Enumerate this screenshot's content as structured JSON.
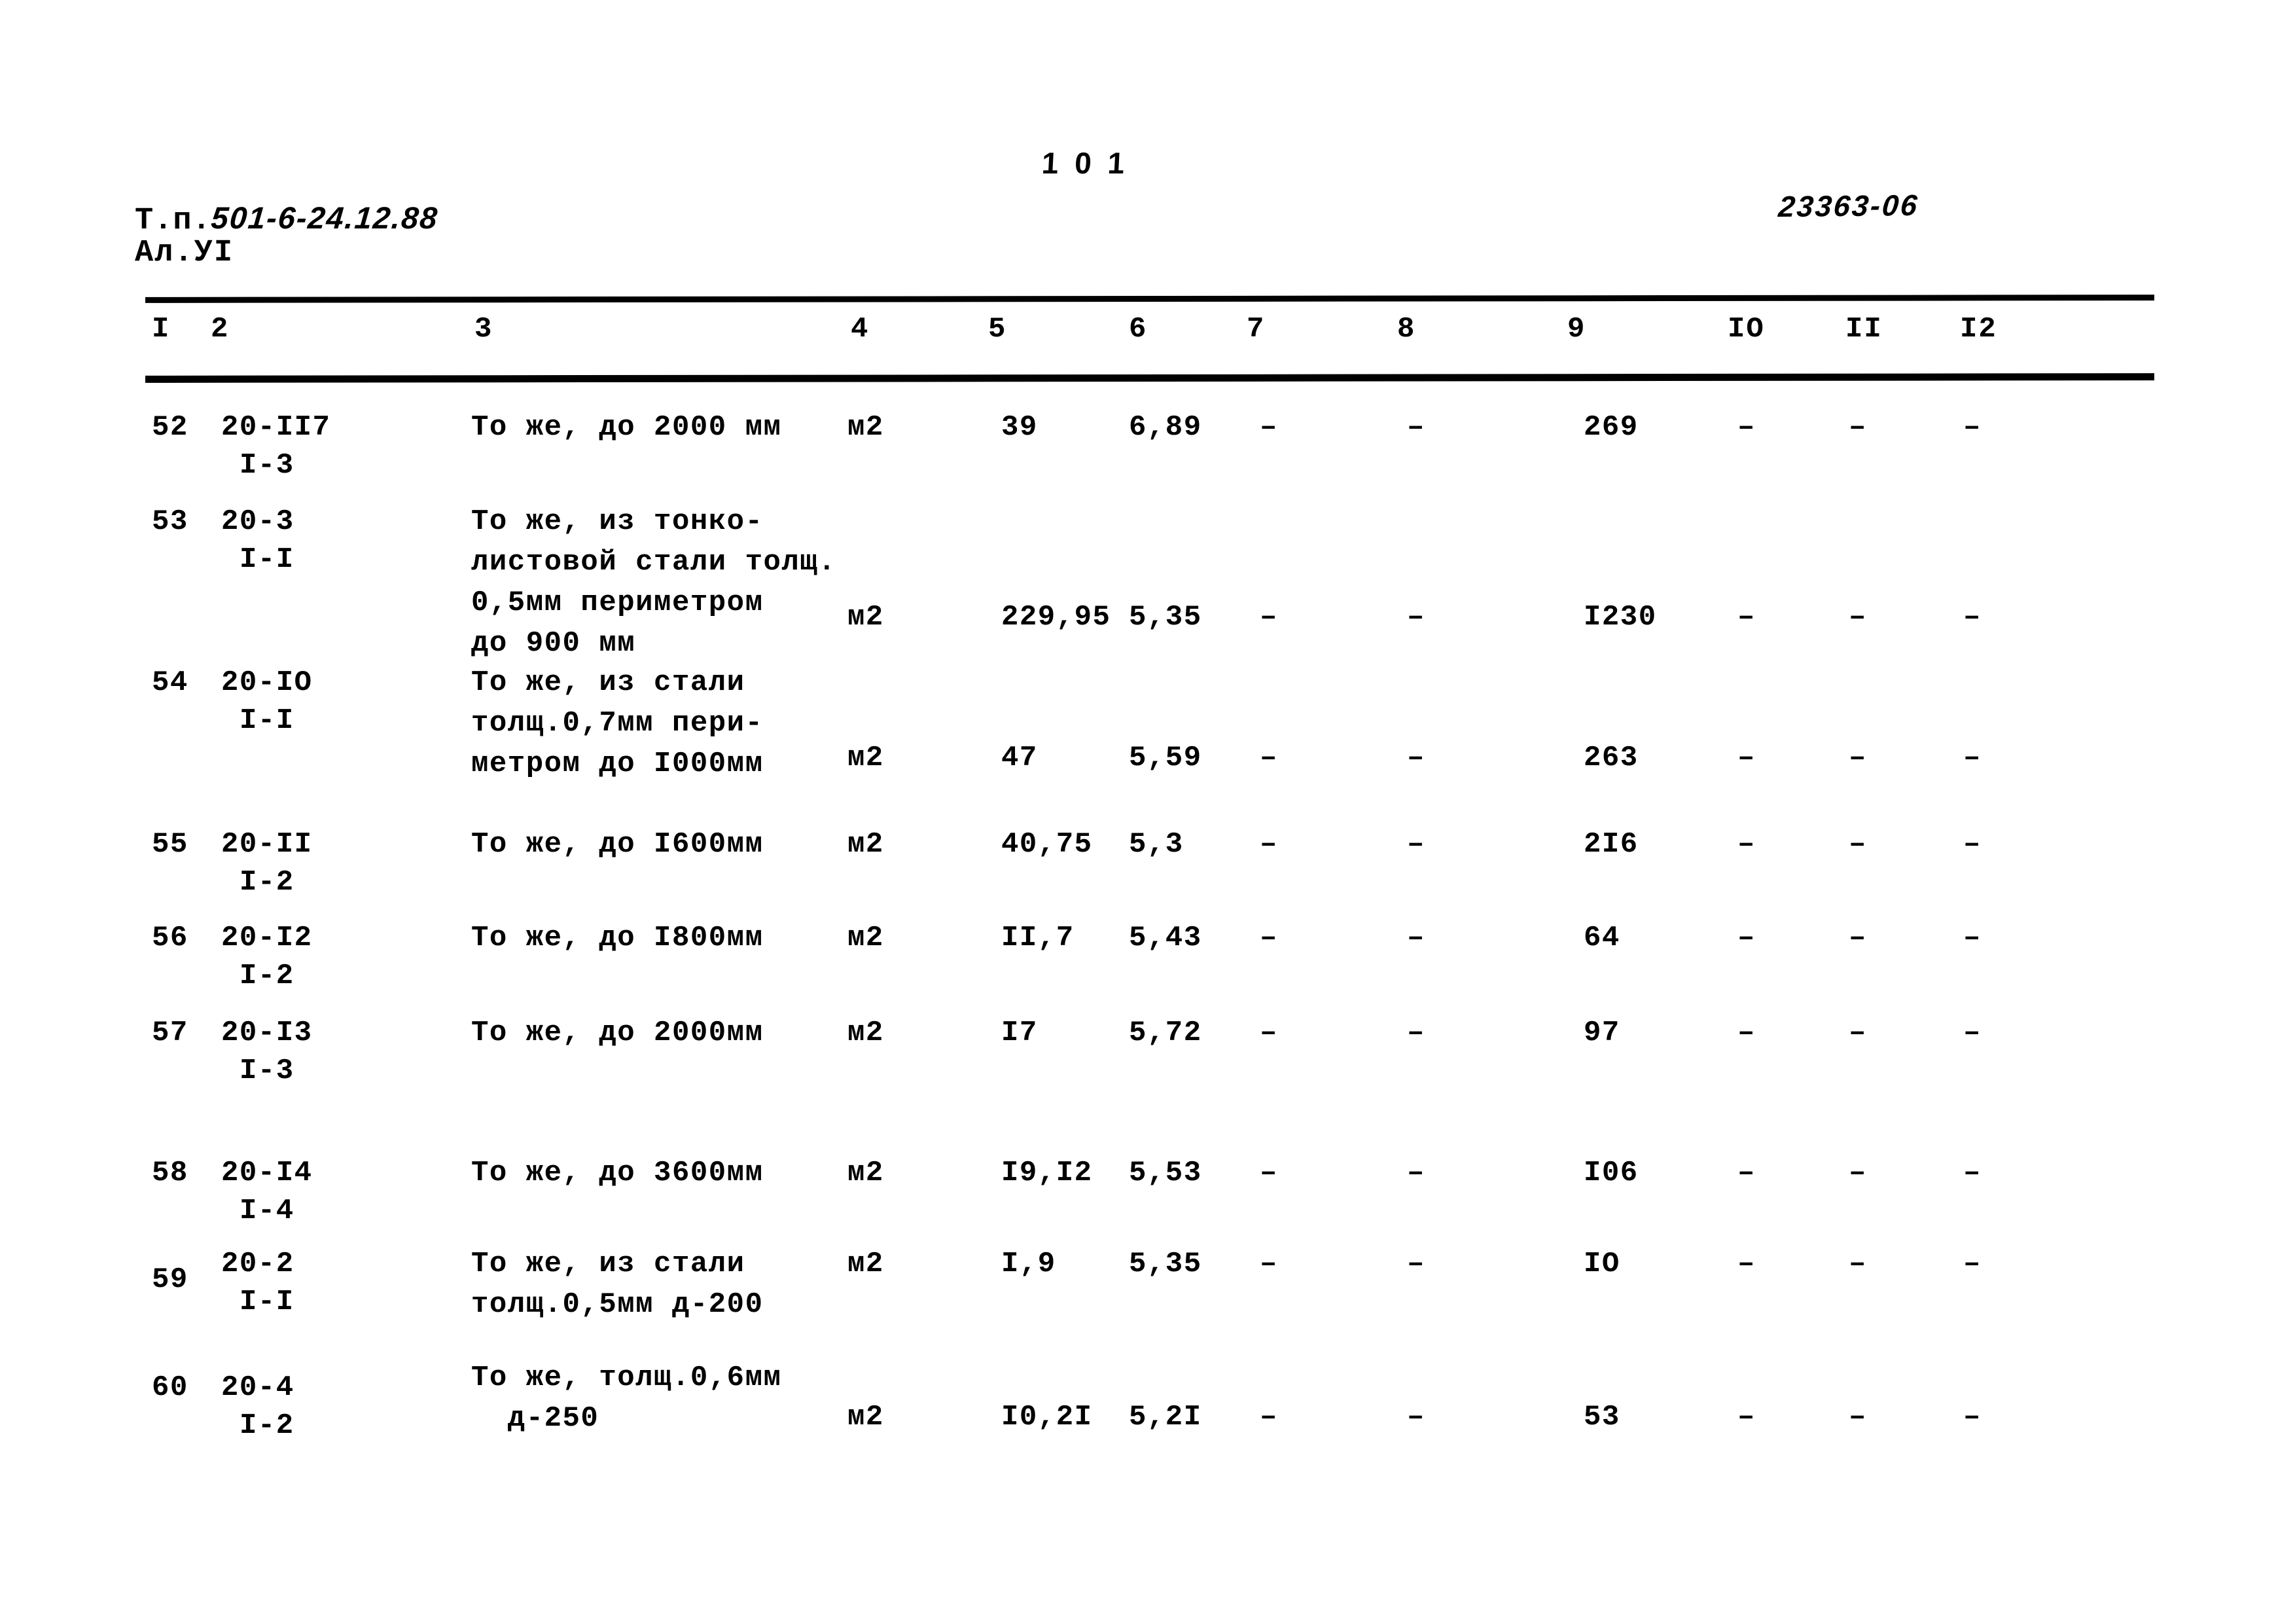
{
  "page": {
    "page_number": "1 0 1",
    "doc_code": "23363-06",
    "tp_prefix": "Т.п.",
    "tp_number": "501-6-24.12.88",
    "album": "Ал.УI"
  },
  "table": {
    "headers": [
      "I",
      "2",
      "3",
      "4",
      "5",
      "6",
      "7",
      "8",
      "9",
      "IO",
      "II",
      "I2"
    ],
    "dash": "–",
    "rows": [
      {
        "no": "52",
        "code": "20-II7",
        "subcode": "I-3",
        "desc": [
          "То же, до 2000 мм"
        ],
        "unit": "м2",
        "qty": "39",
        "price": "6,89",
        "c7": "–",
        "c8": "–",
        "c9": "269",
        "c10": "–",
        "c11": "–",
        "c12": "–"
      },
      {
        "no": "53",
        "code": "20-3",
        "subcode": "I-I",
        "desc": [
          "То же, из тонко-",
          "листовой стали толщ.",
          "0,5мм периметром",
          "до 900 мм"
        ],
        "unit": "м2",
        "qty": "229,95",
        "price": "5,35",
        "c7": "–",
        "c8": "–",
        "c9": "I230",
        "c10": "–",
        "c11": "–",
        "c12": "–"
      },
      {
        "no": "54",
        "code": "20-IO",
        "subcode": "I-I",
        "desc": [
          "То же, из стали",
          "толщ.0,7мм пери-",
          "метром до I000мм"
        ],
        "unit": "м2",
        "qty": "47",
        "price": "5,59",
        "c7": "–",
        "c8": "–",
        "c9": "263",
        "c10": "–",
        "c11": "–",
        "c12": "–"
      },
      {
        "no": "55",
        "code": "20-II",
        "subcode": "I-2",
        "desc": [
          "То же, до I600мм"
        ],
        "unit": "м2",
        "qty": "40,75",
        "price": "5,3",
        "c7": "–",
        "c8": "–",
        "c9": "2I6",
        "c10": "–",
        "c11": "–",
        "c12": "–"
      },
      {
        "no": "56",
        "code": "20-I2",
        "subcode": "I-2",
        "desc": [
          "То же, до I800мм"
        ],
        "unit": "м2",
        "qty": "II,7",
        "price": "5,43",
        "c7": "–",
        "c8": "–",
        "c9": "64",
        "c10": "–",
        "c11": "–",
        "c12": "–"
      },
      {
        "no": "57",
        "code": "20-I3",
        "subcode": "I-3",
        "desc": [
          "То же, до 2000мм"
        ],
        "unit": "м2",
        "qty": "I7",
        "price": "5,72",
        "c7": "–",
        "c8": "–",
        "c9": "97",
        "c10": "–",
        "c11": "–",
        "c12": "–"
      },
      {
        "no": "58",
        "code": "20-I4",
        "subcode": "I-4",
        "desc": [
          "То же, до 3600мм"
        ],
        "unit": "м2",
        "qty": "I9,I2",
        "price": "5,53",
        "c7": "–",
        "c8": "–",
        "c9": "I06",
        "c10": "–",
        "c11": "–",
        "c12": "–"
      },
      {
        "no": "59",
        "code": "20-2",
        "subcode": "I-I",
        "desc": [
          "То же, из стали",
          "толщ.0,5мм д-200"
        ],
        "unit": "м2",
        "qty": "I,9",
        "price": "5,35",
        "c7": "–",
        "c8": "–",
        "c9": "IO",
        "c10": "–",
        "c11": "–",
        "c12": "–"
      },
      {
        "no": "60",
        "code": "20-4",
        "subcode": "I-2",
        "desc": [
          "То же, толщ.0,6мм",
          "  д-250"
        ],
        "unit": "м2",
        "qty": "I0,2I",
        "price": "5,2I",
        "c7": "–",
        "c8": "–",
        "c9": "53",
        "c10": "–",
        "c11": "–",
        "c12": "–"
      }
    ]
  }
}
